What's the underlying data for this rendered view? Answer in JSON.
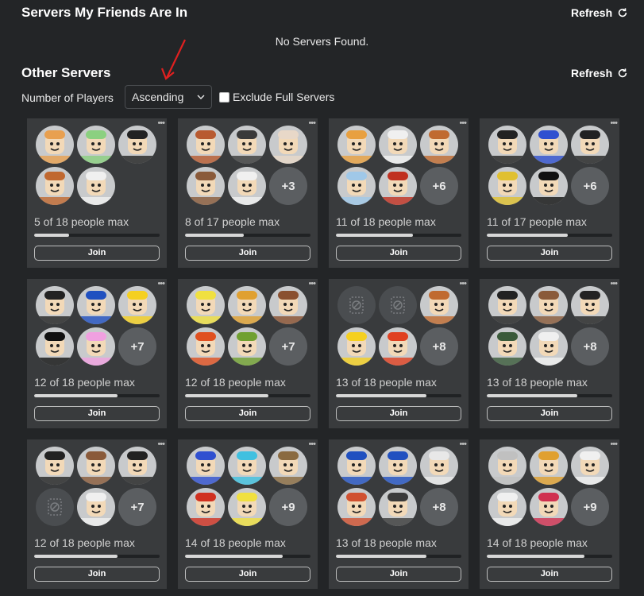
{
  "friends_section": {
    "title": "Servers My Friends Are In",
    "refresh_label": "Refresh",
    "empty_message": "No Servers Found."
  },
  "other_section": {
    "title": "Other Servers",
    "refresh_label": "Refresh",
    "filter_label": "Number of Players",
    "sort_value": "Ascending",
    "exclude_full_label": "Exclude Full Servers",
    "exclude_full_checked": false
  },
  "servers": [
    {
      "capacity": "5 of 18 people max",
      "players": 5,
      "max": 18,
      "overflow": "",
      "avatars": [
        "#e8a050",
        "#8bd080",
        "#222222",
        "#c06830",
        "#f0f0f0"
      ],
      "join_label": "Join"
    },
    {
      "capacity": "8 of 17 people max",
      "players": 8,
      "max": 17,
      "overflow": "+3",
      "avatars": [
        "#b85a30",
        "#3a3a3a",
        "#e8d8c8",
        "#8a5a3a",
        "#f0f0f0"
      ],
      "join_label": "Join"
    },
    {
      "capacity": "11 of 18 people max",
      "players": 11,
      "max": 18,
      "overflow": "+6",
      "avatars": [
        "#e8a040",
        "#f0f0f0",
        "#c06a30",
        "#a0c8e8",
        "#c03020"
      ],
      "join_label": "Join"
    },
    {
      "capacity": "11 of 17 people max",
      "players": 11,
      "max": 17,
      "overflow": "+6",
      "avatars": [
        "#222222",
        "#3050d0",
        "#222222",
        "#e0c030",
        "#111111"
      ],
      "join_label": "Join"
    },
    {
      "capacity": "12 of 18 people max",
      "players": 12,
      "max": 18,
      "overflow": "+7",
      "avatars": [
        "#222222",
        "#2050c0",
        "#f5d020",
        "#101010",
        "#f0a0e0"
      ],
      "join_label": "Join"
    },
    {
      "capacity": "12 of 18 people max",
      "players": 12,
      "max": 18,
      "overflow": "+7",
      "avatars": [
        "#f0e040",
        "#e0a030",
        "#8a5030",
        "#e05020",
        "#70a030"
      ],
      "join_label": "Join"
    },
    {
      "capacity": "13 of 18 people max",
      "players": 13,
      "max": 18,
      "overflow": "+8",
      "avatars": [
        "blocked",
        "blocked",
        "#c06a30",
        "#f5d020",
        "#e04020"
      ],
      "join_label": "Join"
    },
    {
      "capacity": "13 of 18 people max",
      "players": 13,
      "max": 18,
      "overflow": "+8",
      "avatars": [
        "#222222",
        "#8a5a3a",
        "#222222",
        "#3a5a3a",
        "#f0f0f0"
      ],
      "join_label": "Join"
    },
    {
      "capacity": "12 of 18 people max",
      "players": 12,
      "max": 18,
      "overflow": "+7",
      "avatars": [
        "#222222",
        "#8a5a3a",
        "#222222",
        "blocked",
        "#f0f0f0"
      ],
      "join_label": "Join"
    },
    {
      "capacity": "14 of 18 people max",
      "players": 14,
      "max": 18,
      "overflow": "+9",
      "avatars": [
        "#3050d0",
        "#40c0e0",
        "#8a6a40",
        "#d03020",
        "#f0e040"
      ],
      "join_label": "Join"
    },
    {
      "capacity": "13 of 18 people max",
      "players": 13,
      "max": 18,
      "overflow": "+8",
      "avatars": [
        "#2050c0",
        "#2050c0",
        "#e8e8e8",
        "#d05030",
        "#3a3a3a"
      ],
      "join_label": "Join"
    },
    {
      "capacity": "14 of 18 people max",
      "players": 14,
      "max": 18,
      "overflow": "+9",
      "avatars": [
        "#c0c0c0",
        "#e0a030",
        "#f0f0f0",
        "#f0f0f0",
        "#d03050"
      ],
      "join_label": "Join"
    }
  ],
  "colors": {
    "background": "#232527",
    "card": "#393b3d",
    "arrow": "#e02020"
  }
}
